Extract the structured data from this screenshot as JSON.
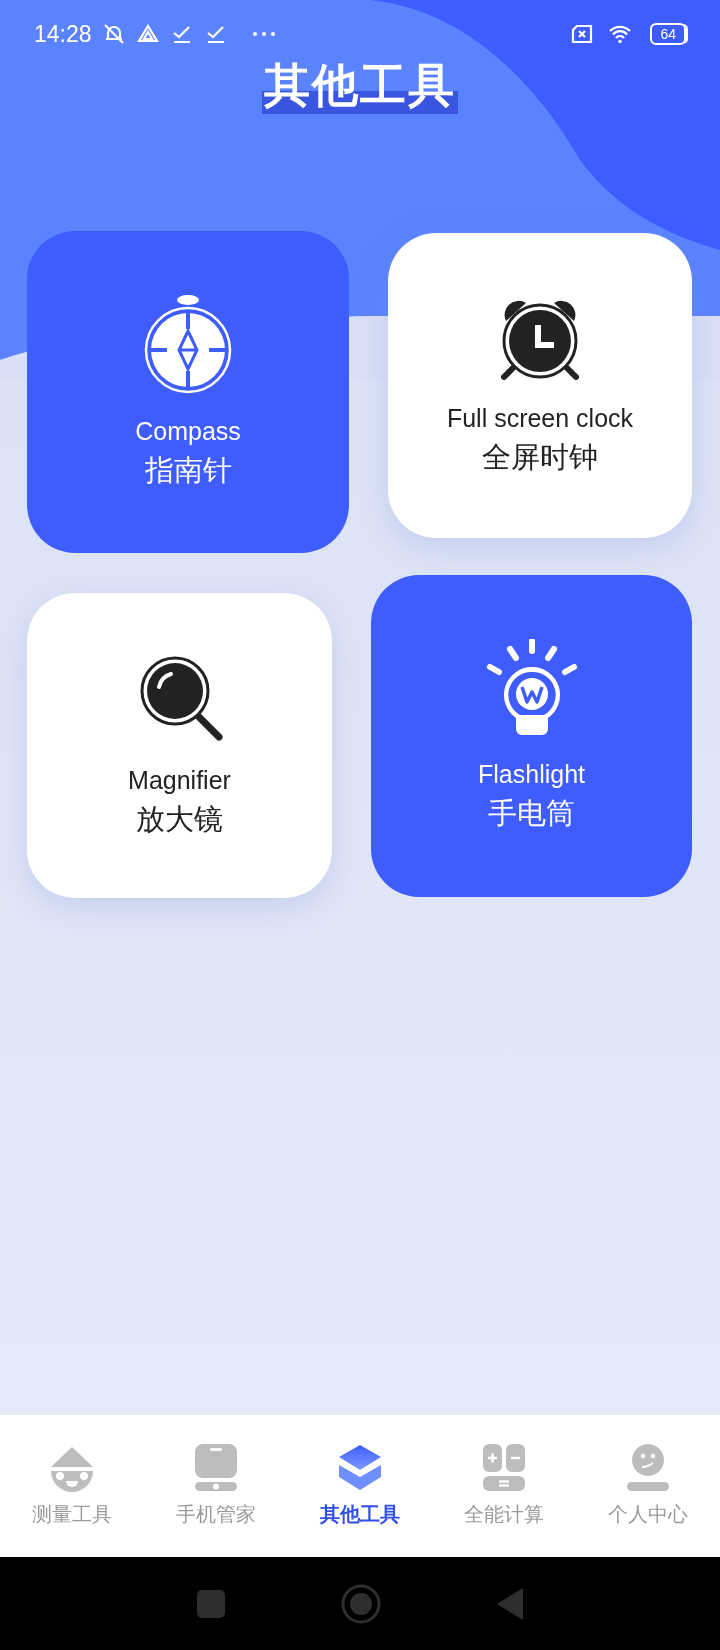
{
  "status_bar": {
    "time": "14:28",
    "battery": "64"
  },
  "title": "其他工具",
  "tools": [
    {
      "kind": "accent",
      "name_en": "Compass",
      "name_zh": "指南针"
    },
    {
      "kind": "plain",
      "name_en": "Full screen clock",
      "name_zh": "全屏时钟"
    },
    {
      "kind": "plain",
      "name_en": "Magnifier",
      "name_zh": "放大镜"
    },
    {
      "kind": "accent",
      "name_en": "Flashlight",
      "name_zh": "手电筒"
    }
  ],
  "tabs": [
    {
      "label": "测量工具",
      "selected": false
    },
    {
      "label": "手机管家",
      "selected": false
    },
    {
      "label": "其他工具",
      "selected": true
    },
    {
      "label": "全能计算",
      "selected": false
    },
    {
      "label": "个人中心",
      "selected": false
    }
  ]
}
